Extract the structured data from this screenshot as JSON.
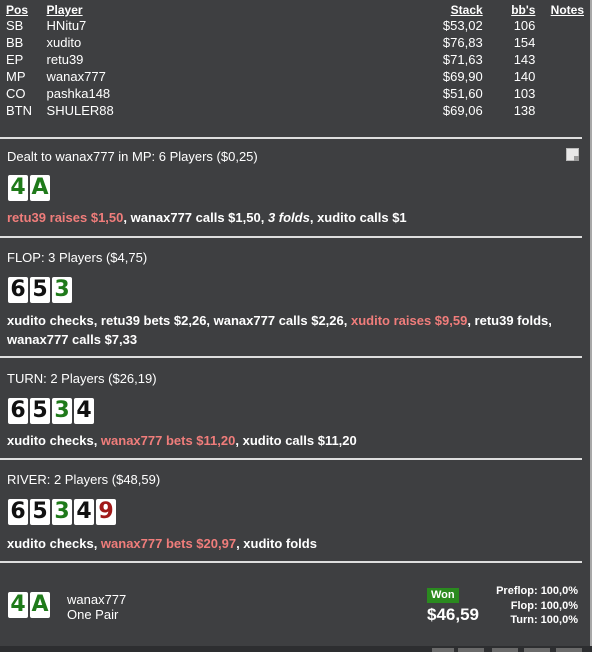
{
  "players_table": {
    "headers": {
      "pos": "Pos",
      "player": "Player",
      "stack": "Stack",
      "bbs": "bb's",
      "notes": "Notes"
    },
    "rows": [
      {
        "pos": "SB",
        "player": "HNitu7",
        "stack": "$53,02",
        "bbs": "106"
      },
      {
        "pos": "BB",
        "player": "xudito",
        "stack": "$76,83",
        "bbs": "154"
      },
      {
        "pos": "EP",
        "player": "retu39",
        "stack": "$71,63",
        "bbs": "143"
      },
      {
        "pos": "MP",
        "player": "wanax777",
        "stack": "$69,90",
        "bbs": "140"
      },
      {
        "pos": "CO",
        "player": "pashka148",
        "stack": "$51,60",
        "bbs": "103"
      },
      {
        "pos": "BTN",
        "player": "SHULER88",
        "stack": "$69,06",
        "bbs": "138"
      }
    ]
  },
  "preflop": {
    "title": "Dealt to wanax777 in MP: 6 Players ($0,25)",
    "note_icon": "note-icon",
    "cards": [
      {
        "rank": "4",
        "suit": "c"
      },
      {
        "rank": "A",
        "suit": "c"
      }
    ],
    "actions": {
      "a1": "retu39 raises $1,50",
      "a2": ", wanax777 calls $1,50, ",
      "a3": "3 folds",
      "a4": ", xudito calls $1"
    }
  },
  "flop": {
    "title": "FLOP: 3 Players ($4,75)",
    "cards": [
      {
        "rank": "6",
        "suit": "s"
      },
      {
        "rank": "5",
        "suit": "s"
      },
      {
        "rank": "3",
        "suit": "c"
      }
    ],
    "actions": {
      "a1": "xudito checks, retu39 bets $2,26, wanax777 calls $2,26, ",
      "a2": "xudito raises $9,59",
      "a3": ", retu39 folds, wanax777 calls $7,33"
    }
  },
  "turn": {
    "title": "TURN: 2 Players ($26,19)",
    "cards": [
      {
        "rank": "6",
        "suit": "s"
      },
      {
        "rank": "5",
        "suit": "s"
      },
      {
        "rank": "3",
        "suit": "c"
      },
      {
        "rank": "4",
        "suit": "s"
      }
    ],
    "actions": {
      "a1": "xudito checks, ",
      "a2": "wanax777 bets $11,20",
      "a3": ", xudito calls $11,20"
    }
  },
  "river": {
    "title": "RIVER: 2 Players ($48,59)",
    "cards": [
      {
        "rank": "6",
        "suit": "s"
      },
      {
        "rank": "5",
        "suit": "s"
      },
      {
        "rank": "3",
        "suit": "c"
      },
      {
        "rank": "4",
        "suit": "s"
      },
      {
        "rank": "9",
        "suit": "h"
      }
    ],
    "actions": {
      "a1": "xudito checks, ",
      "a2": "wanax777 bets $20,97",
      "a3": ", xudito folds"
    }
  },
  "summary": {
    "cards": [
      {
        "rank": "4",
        "suit": "c"
      },
      {
        "rank": "A",
        "suit": "c"
      }
    ],
    "player": "wanax777",
    "hand": "One Pair",
    "won_label": "Won",
    "won_amount": "$46,59",
    "equity": {
      "preflop": "Preflop: 100,0%",
      "flop": "Flop: 100,0%",
      "turn": "Turn: 100,0%"
    }
  },
  "colors": {
    "background": "#3e3f41",
    "highlight_action": "#f07d7b",
    "won_badge": "#2a8a1f",
    "suit_spade": "#111111",
    "suit_club": "#1f7a1a",
    "suit_heart": "#a01818"
  }
}
